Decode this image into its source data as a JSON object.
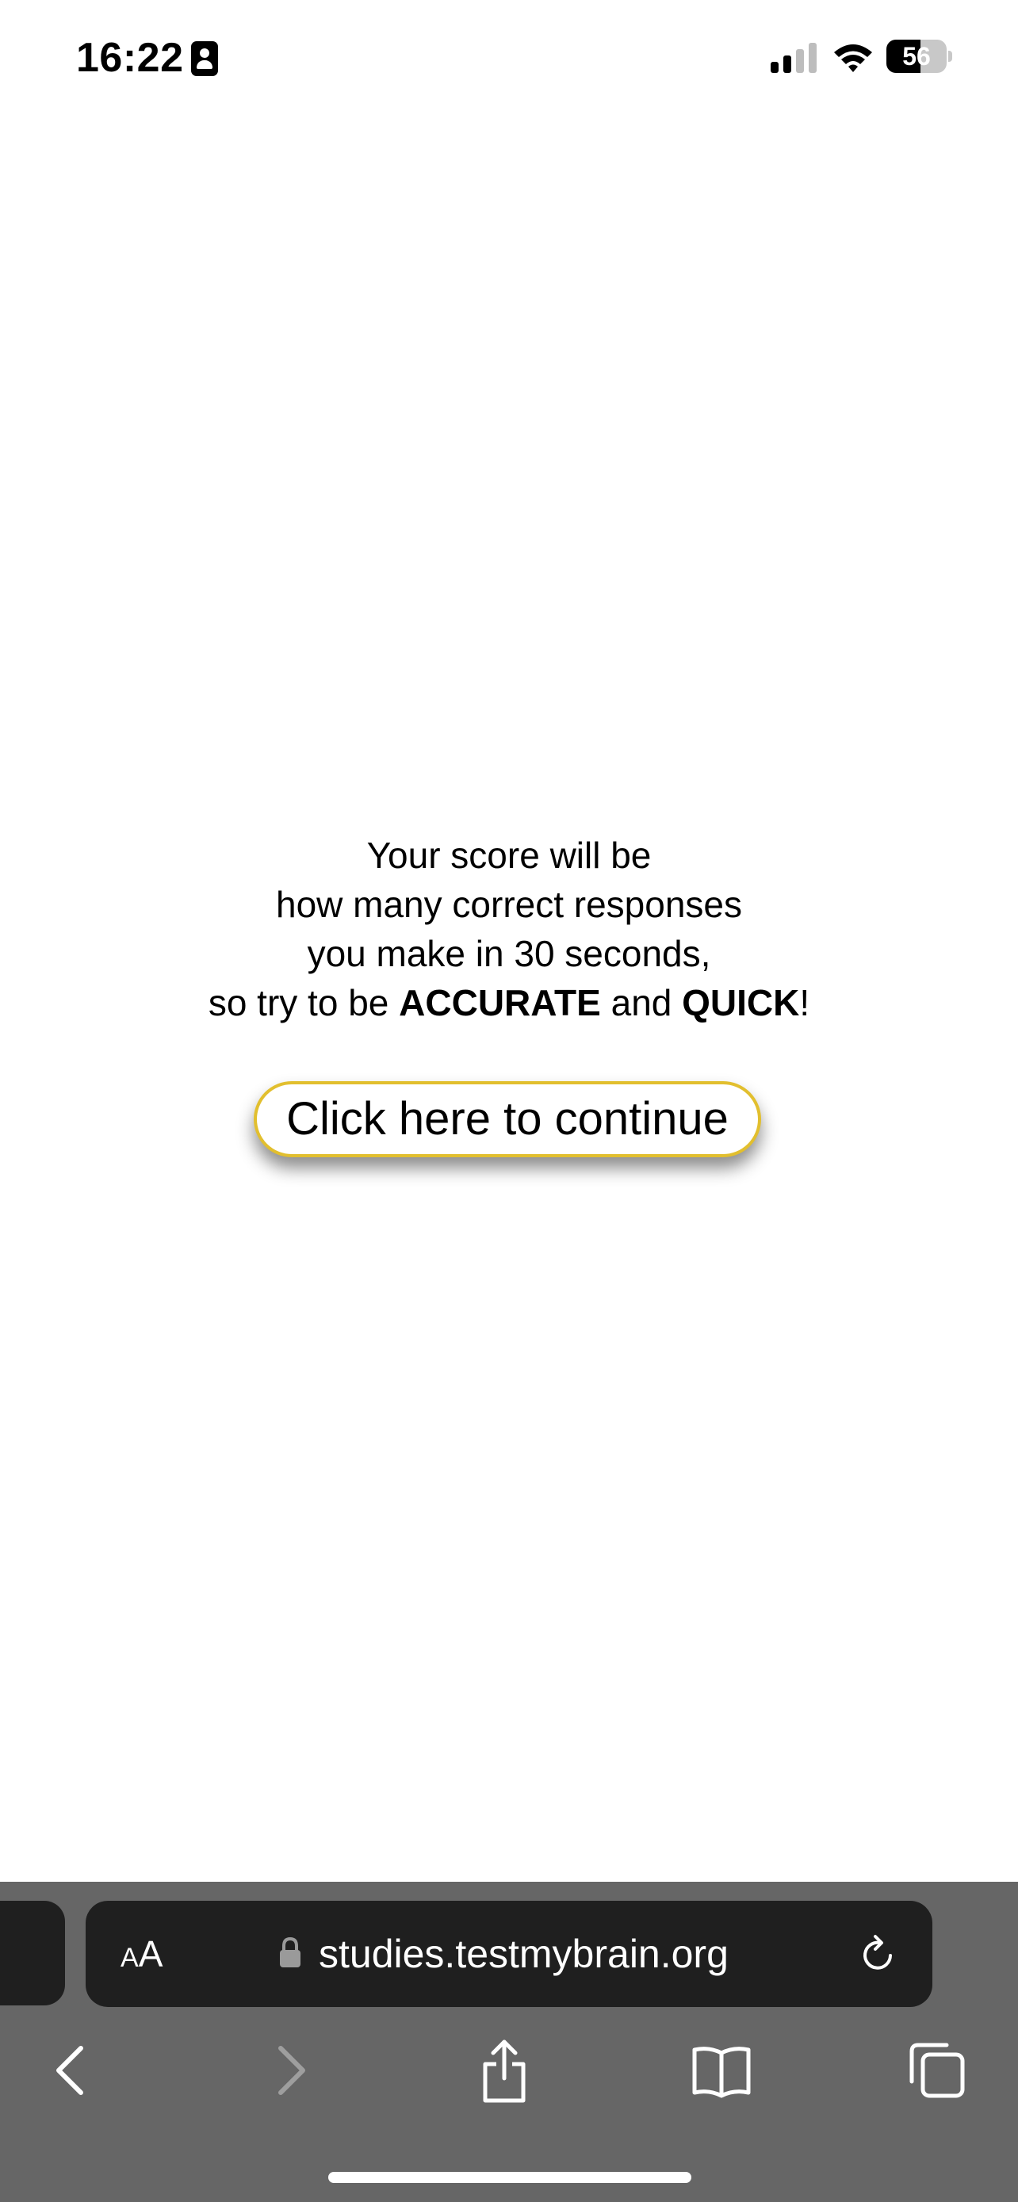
{
  "status_bar": {
    "time": "16:22",
    "battery_level": "56"
  },
  "main": {
    "instruction_lines": [
      "Your score will be",
      "how many correct responses",
      "you make in 30 seconds,"
    ],
    "last_line": {
      "prefix": "so try to be ",
      "emphasis_1": "ACCURATE",
      "middle": " and ",
      "emphasis_2": "QUICK",
      "suffix": "!"
    },
    "continue_button_label": "Click here to continue"
  },
  "browser": {
    "aa_small": "A",
    "aa_large": "A",
    "url": "studies.testmybrain.org"
  },
  "colors": {
    "button_border": "#e2bf2e",
    "toolbar_bg": "#666666",
    "address_bar_bg": "#1f1f1f"
  }
}
